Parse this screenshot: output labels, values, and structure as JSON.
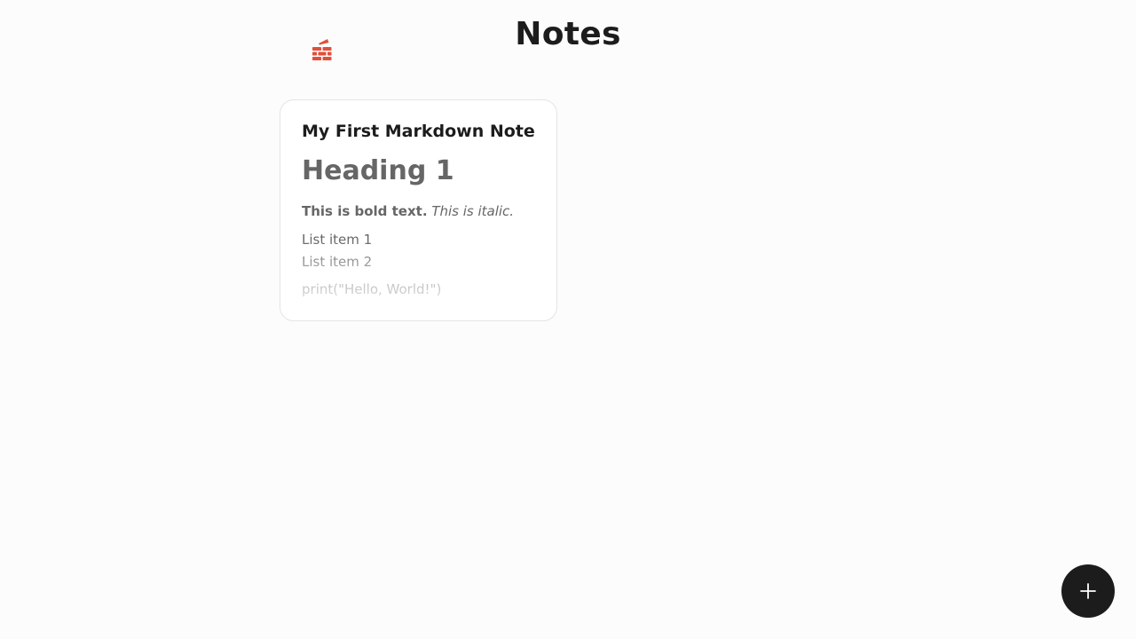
{
  "header": {
    "title": "Notes",
    "logo_icon": "brick-wall-icon",
    "logo_color": "#e0503a"
  },
  "notes": [
    {
      "title": "My First Markdown Note",
      "preview": {
        "heading": "Heading 1",
        "bold_text": "This is bold text.",
        "italic_text": "This is italic.",
        "list_items": [
          "List item 1",
          "List item 2"
        ],
        "code": "print(\"Hello, World!\")"
      }
    }
  ],
  "fab": {
    "icon": "plus-icon",
    "color": "#1c1c1c"
  }
}
